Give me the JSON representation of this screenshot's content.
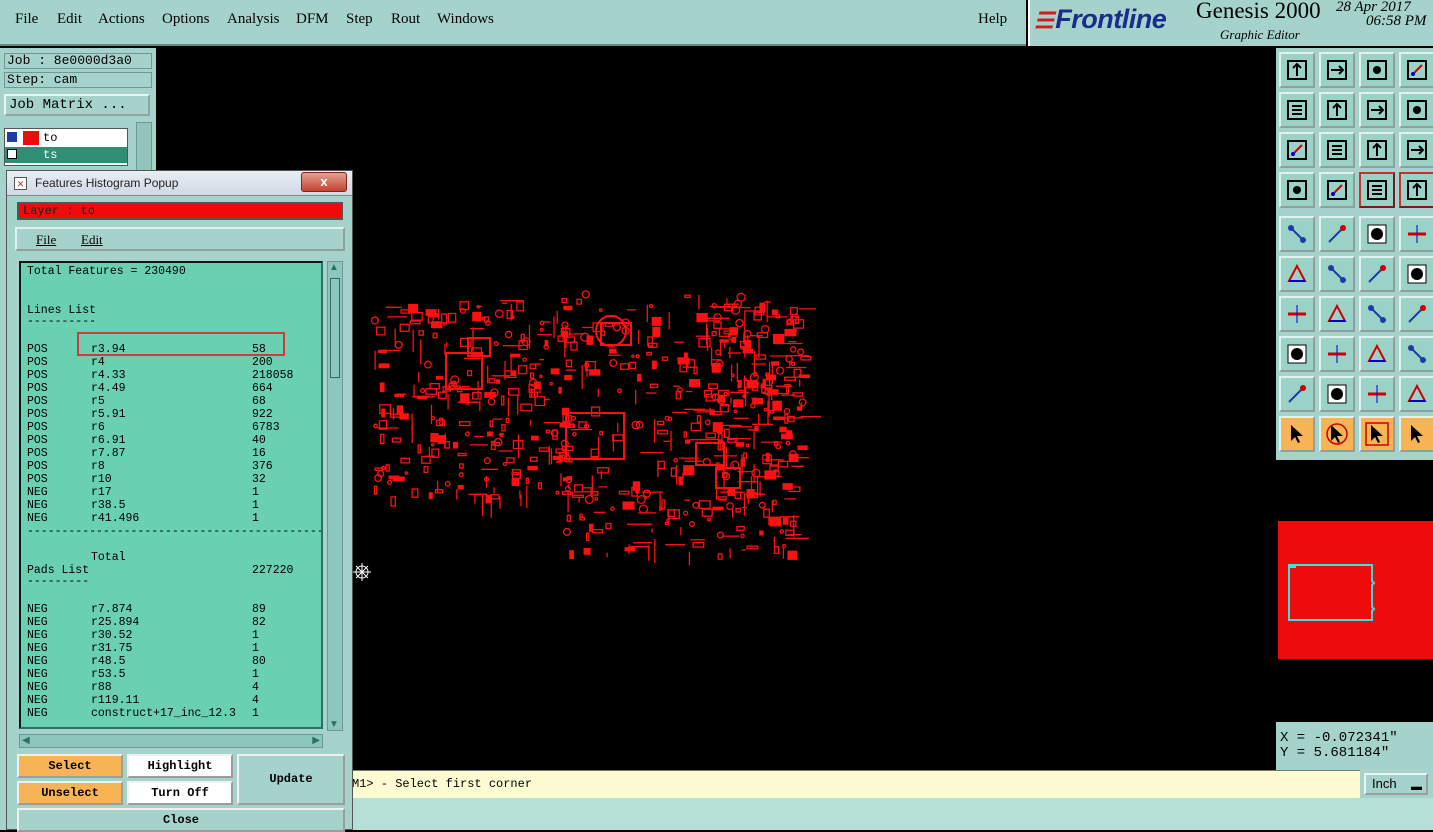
{
  "menubar": {
    "items": [
      {
        "label": "File"
      },
      {
        "label": "Edit"
      },
      {
        "label": "Actions"
      },
      {
        "label": "Options"
      },
      {
        "label": "Analysis"
      },
      {
        "label": "DFM"
      },
      {
        "label": "Step"
      },
      {
        "label": "Rout"
      },
      {
        "label": "Windows"
      }
    ],
    "help": "Help"
  },
  "brand": {
    "logo": "Frontline",
    "product": "Genesis 2000",
    "subtitle": "Graphic Editor",
    "date": "28 Apr 2017",
    "time": "06:58 PM"
  },
  "left_panel": {
    "job": "Job : 8e0000d3a0",
    "step": "Step: cam",
    "job_matrix_button": "Job Matrix ...",
    "layers": [
      {
        "name": "to",
        "color": "#f00a0a"
      },
      {
        "name": "ts",
        "color": "#2e8f75"
      }
    ]
  },
  "popup": {
    "title": "Features Histogram Popup",
    "close_glyph": "x",
    "layer_label": "Layer :  to",
    "menu": {
      "file": "File",
      "edit": "Edit"
    },
    "total_features": "Total Features = 230490",
    "lines_header": "Lines List",
    "lines_underline": "----------",
    "lines": [
      {
        "polarity": "POS",
        "symbol": "r3.94",
        "count": "58"
      },
      {
        "polarity": "POS",
        "symbol": "r4",
        "count": "200"
      },
      {
        "polarity": "POS",
        "symbol": "r4.33",
        "count": "218058"
      },
      {
        "polarity": "POS",
        "symbol": "r4.49",
        "count": "664"
      },
      {
        "polarity": "POS",
        "symbol": "r5",
        "count": "68"
      },
      {
        "polarity": "POS",
        "symbol": "r5.91",
        "count": "922"
      },
      {
        "polarity": "POS",
        "symbol": "r6",
        "count": "6783"
      },
      {
        "polarity": "POS",
        "symbol": "r6.91",
        "count": "40"
      },
      {
        "polarity": "POS",
        "symbol": "r7.87",
        "count": "16"
      },
      {
        "polarity": "POS",
        "symbol": "r8",
        "count": "376"
      },
      {
        "polarity": "POS",
        "symbol": "r10",
        "count": "32"
      },
      {
        "polarity": "NEG",
        "symbol": "r17",
        "count": "1"
      },
      {
        "polarity": "NEG",
        "symbol": "r38.5",
        "count": "1"
      },
      {
        "polarity": "NEG",
        "symbol": "r41.496",
        "count": "1"
      }
    ],
    "divider": "-------------------------------------------",
    "total_label": "Total",
    "total_value": "227220",
    "pads_header": "Pads List",
    "pads_underline": "---------",
    "pads": [
      {
        "polarity": "NEG",
        "symbol": "r7.874",
        "count": "89"
      },
      {
        "polarity": "NEG",
        "symbol": "r25.894",
        "count": "82"
      },
      {
        "polarity": "NEG",
        "symbol": "r30.52",
        "count": "1"
      },
      {
        "polarity": "NEG",
        "symbol": "r31.75",
        "count": "1"
      },
      {
        "polarity": "NEG",
        "symbol": "r48.5",
        "count": "80"
      },
      {
        "polarity": "NEG",
        "symbol": "r53.5",
        "count": "1"
      },
      {
        "polarity": "NEG",
        "symbol": "r88",
        "count": "4"
      },
      {
        "polarity": "NEG",
        "symbol": "r119.11",
        "count": "4"
      },
      {
        "polarity": "NEG",
        "symbol": "construct+17_inc_12.3",
        "count": "1"
      }
    ],
    "buttons": {
      "select": "Select",
      "highlight": "Highlight",
      "update": "Update",
      "unselect": "Unselect",
      "turn_off": "Turn Off",
      "close": "Close"
    }
  },
  "status": {
    "message": "M1> - Select first corner",
    "unit": "Inch"
  },
  "coords": {
    "x": "X = -0.072341\"",
    "y": "Y = 5.681184\""
  },
  "toolbox": {
    "icons": [
      "move-up-icon",
      "move-down-icon",
      "home-icon",
      "window-split-icon",
      "move-left-icon",
      "move-right-icon",
      "undo-zoom-icon",
      "redraw-icon",
      "fit-screen-icon",
      "zoom-center-icon",
      "one-to-two-icon",
      "help-icon",
      "measure-tool-icon",
      "probe-icon",
      "net-highlight-icon",
      "net-select-icon",
      "pad-symbol-icon",
      "polygon-icon",
      "ruler-icon",
      "circle-fill-icon",
      "connect-nodes-icon",
      "cross-icon",
      "line-red-icon",
      "line-blue-icon",
      "angle-icon",
      "diagonal-line-icon",
      "arc-icon",
      "flip-text-icon",
      "node-move-icon",
      "segment-icon",
      "measure-box-icon",
      "component-icon",
      "triangle-outline-icon",
      "triangle-a-icon",
      "arch-icon",
      "triangle-x-icon",
      "pointer-icon",
      "pointer-box-icon",
      "pointer-circle-icon",
      "pointer-route-icon"
    ]
  }
}
